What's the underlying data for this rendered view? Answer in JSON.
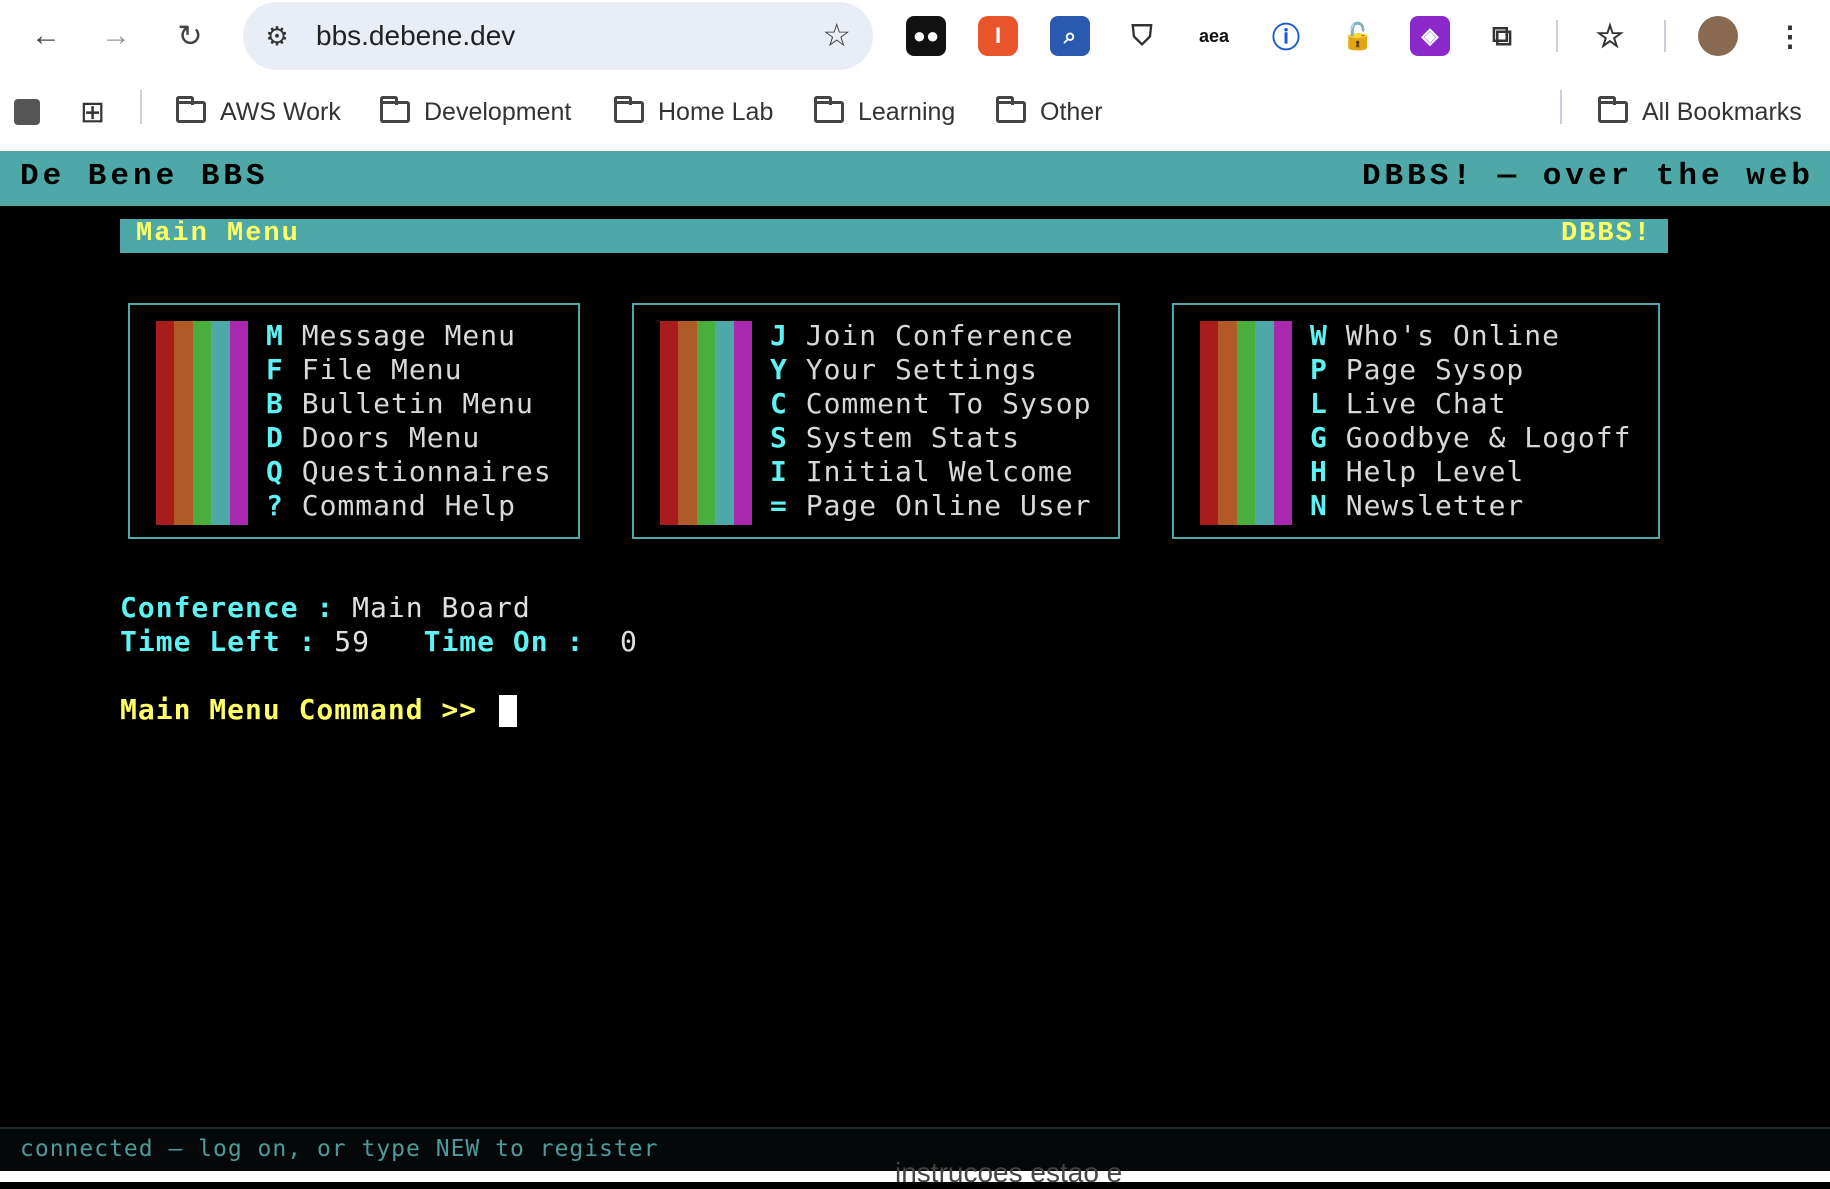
{
  "browser": {
    "url": "bbs.debene.dev",
    "bookmarks": [
      "AWS Work",
      "Development",
      "Home Lab",
      "Learning",
      "Other"
    ],
    "all_bookmarks": "All Bookmarks",
    "ext_labels": {
      "aea": "aea"
    }
  },
  "terminal": {
    "title_left": "De Bene BBS",
    "title_right": "DBBS! — over the web",
    "menu_title": "Main Menu",
    "menu_tag": "DBBS!",
    "bar_colors": [
      "#a81c1c",
      "#b05a28",
      "#4aae3c",
      "#4ea8a8",
      "#a828b0"
    ],
    "columns": [
      {
        "items": [
          {
            "key": "M",
            "label": "Message Menu"
          },
          {
            "key": "F",
            "label": "File Menu"
          },
          {
            "key": "B",
            "label": "Bulletin Menu"
          },
          {
            "key": "D",
            "label": "Doors Menu"
          },
          {
            "key": "Q",
            "label": "Questionnaires"
          },
          {
            "key": "?",
            "label": "Command Help"
          }
        ]
      },
      {
        "items": [
          {
            "key": "J",
            "label": "Join Conference"
          },
          {
            "key": "Y",
            "label": "Your Settings"
          },
          {
            "key": "C",
            "label": "Comment To Sysop"
          },
          {
            "key": "S",
            "label": "System Stats"
          },
          {
            "key": "I",
            "label": "Initial Welcome"
          },
          {
            "key": "=",
            "label": "Page Online User"
          }
        ]
      },
      {
        "items": [
          {
            "key": "W",
            "label": "Who's Online"
          },
          {
            "key": "P",
            "label": "Page Sysop"
          },
          {
            "key": "L",
            "label": "Live Chat"
          },
          {
            "key": "G",
            "label": "Goodbye & Logoff"
          },
          {
            "key": "H",
            "label": "Help Level"
          },
          {
            "key": "N",
            "label": "Newsletter"
          }
        ]
      }
    ],
    "conference_label": "Conference :",
    "conference_value": "Main Board",
    "time_left_label": "Time Left :",
    "time_left_value": "59",
    "time_on_label": "Time On :",
    "time_on_value": "0",
    "prompt": "Main Menu Command >>",
    "status": "connected — log on, or type NEW to register",
    "below_text": "instrucoes estao e"
  }
}
